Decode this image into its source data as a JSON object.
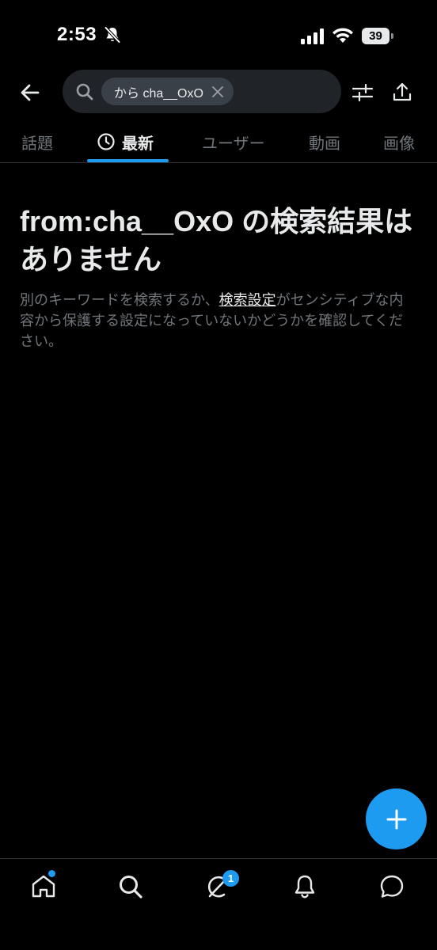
{
  "status_bar": {
    "time": "2:53",
    "battery_level": "39",
    "icons": [
      "bell-off-icon",
      "signal-icon",
      "wifi-icon",
      "battery-icon"
    ]
  },
  "header": {
    "back_icon": "arrow-left-icon",
    "search_icon": "search-icon",
    "chip_label": "から cha__OxO",
    "chip_close_icon": "close-icon",
    "filter_icon": "sliders-icon",
    "share_icon": "share-icon"
  },
  "tabs": [
    {
      "label": "話題",
      "active": false
    },
    {
      "label": "最新",
      "active": true,
      "icon": "clock-icon"
    },
    {
      "label": "ユーザー",
      "active": false
    },
    {
      "label": "動画",
      "active": false
    },
    {
      "label": "画像",
      "active": false
    }
  ],
  "empty_state": {
    "title": "from:cha__OxO の検索結果はありません",
    "body_before": "別のキーワードを検索するか、",
    "body_link": "検索設定",
    "body_after": "がセンシティブな内容から保護する設定になっていないかどうかを確認してください。"
  },
  "fab": {
    "icon": "plus-icon"
  },
  "bottom_nav": {
    "items": [
      "home-icon",
      "search-icon",
      "grok-icon",
      "bell-icon",
      "messages-icon"
    ],
    "grok_badge": "1"
  },
  "colors": {
    "accent": "#1d9bf0",
    "background": "#000000",
    "text_primary": "#e7e9ea",
    "text_secondary": "#71767b",
    "search_bg": "#202327",
    "chip_bg": "#3a4048"
  }
}
